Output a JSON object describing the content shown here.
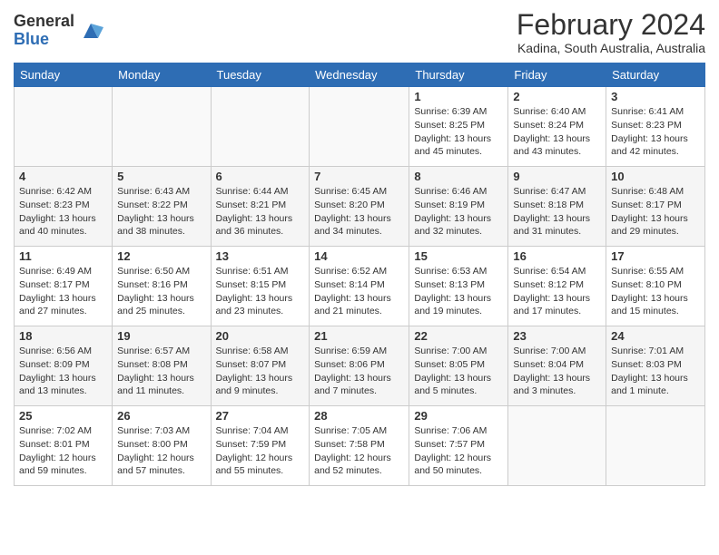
{
  "logo": {
    "general": "General",
    "blue": "Blue"
  },
  "header": {
    "month": "February 2024",
    "location": "Kadina, South Australia, Australia"
  },
  "weekdays": [
    "Sunday",
    "Monday",
    "Tuesday",
    "Wednesday",
    "Thursday",
    "Friday",
    "Saturday"
  ],
  "weeks": [
    [
      {
        "day": "",
        "info": ""
      },
      {
        "day": "",
        "info": ""
      },
      {
        "day": "",
        "info": ""
      },
      {
        "day": "",
        "info": ""
      },
      {
        "day": "1",
        "info": "Sunrise: 6:39 AM\nSunset: 8:25 PM\nDaylight: 13 hours and 45 minutes."
      },
      {
        "day": "2",
        "info": "Sunrise: 6:40 AM\nSunset: 8:24 PM\nDaylight: 13 hours and 43 minutes."
      },
      {
        "day": "3",
        "info": "Sunrise: 6:41 AM\nSunset: 8:23 PM\nDaylight: 13 hours and 42 minutes."
      }
    ],
    [
      {
        "day": "4",
        "info": "Sunrise: 6:42 AM\nSunset: 8:23 PM\nDaylight: 13 hours and 40 minutes."
      },
      {
        "day": "5",
        "info": "Sunrise: 6:43 AM\nSunset: 8:22 PM\nDaylight: 13 hours and 38 minutes."
      },
      {
        "day": "6",
        "info": "Sunrise: 6:44 AM\nSunset: 8:21 PM\nDaylight: 13 hours and 36 minutes."
      },
      {
        "day": "7",
        "info": "Sunrise: 6:45 AM\nSunset: 8:20 PM\nDaylight: 13 hours and 34 minutes."
      },
      {
        "day": "8",
        "info": "Sunrise: 6:46 AM\nSunset: 8:19 PM\nDaylight: 13 hours and 32 minutes."
      },
      {
        "day": "9",
        "info": "Sunrise: 6:47 AM\nSunset: 8:18 PM\nDaylight: 13 hours and 31 minutes."
      },
      {
        "day": "10",
        "info": "Sunrise: 6:48 AM\nSunset: 8:17 PM\nDaylight: 13 hours and 29 minutes."
      }
    ],
    [
      {
        "day": "11",
        "info": "Sunrise: 6:49 AM\nSunset: 8:17 PM\nDaylight: 13 hours and 27 minutes."
      },
      {
        "day": "12",
        "info": "Sunrise: 6:50 AM\nSunset: 8:16 PM\nDaylight: 13 hours and 25 minutes."
      },
      {
        "day": "13",
        "info": "Sunrise: 6:51 AM\nSunset: 8:15 PM\nDaylight: 13 hours and 23 minutes."
      },
      {
        "day": "14",
        "info": "Sunrise: 6:52 AM\nSunset: 8:14 PM\nDaylight: 13 hours and 21 minutes."
      },
      {
        "day": "15",
        "info": "Sunrise: 6:53 AM\nSunset: 8:13 PM\nDaylight: 13 hours and 19 minutes."
      },
      {
        "day": "16",
        "info": "Sunrise: 6:54 AM\nSunset: 8:12 PM\nDaylight: 13 hours and 17 minutes."
      },
      {
        "day": "17",
        "info": "Sunrise: 6:55 AM\nSunset: 8:10 PM\nDaylight: 13 hours and 15 minutes."
      }
    ],
    [
      {
        "day": "18",
        "info": "Sunrise: 6:56 AM\nSunset: 8:09 PM\nDaylight: 13 hours and 13 minutes."
      },
      {
        "day": "19",
        "info": "Sunrise: 6:57 AM\nSunset: 8:08 PM\nDaylight: 13 hours and 11 minutes."
      },
      {
        "day": "20",
        "info": "Sunrise: 6:58 AM\nSunset: 8:07 PM\nDaylight: 13 hours and 9 minutes."
      },
      {
        "day": "21",
        "info": "Sunrise: 6:59 AM\nSunset: 8:06 PM\nDaylight: 13 hours and 7 minutes."
      },
      {
        "day": "22",
        "info": "Sunrise: 7:00 AM\nSunset: 8:05 PM\nDaylight: 13 hours and 5 minutes."
      },
      {
        "day": "23",
        "info": "Sunrise: 7:00 AM\nSunset: 8:04 PM\nDaylight: 13 hours and 3 minutes."
      },
      {
        "day": "24",
        "info": "Sunrise: 7:01 AM\nSunset: 8:03 PM\nDaylight: 13 hours and 1 minute."
      }
    ],
    [
      {
        "day": "25",
        "info": "Sunrise: 7:02 AM\nSunset: 8:01 PM\nDaylight: 12 hours and 59 minutes."
      },
      {
        "day": "26",
        "info": "Sunrise: 7:03 AM\nSunset: 8:00 PM\nDaylight: 12 hours and 57 minutes."
      },
      {
        "day": "27",
        "info": "Sunrise: 7:04 AM\nSunset: 7:59 PM\nDaylight: 12 hours and 55 minutes."
      },
      {
        "day": "28",
        "info": "Sunrise: 7:05 AM\nSunset: 7:58 PM\nDaylight: 12 hours and 52 minutes."
      },
      {
        "day": "29",
        "info": "Sunrise: 7:06 AM\nSunset: 7:57 PM\nDaylight: 12 hours and 50 minutes."
      },
      {
        "day": "",
        "info": ""
      },
      {
        "day": "",
        "info": ""
      }
    ]
  ]
}
